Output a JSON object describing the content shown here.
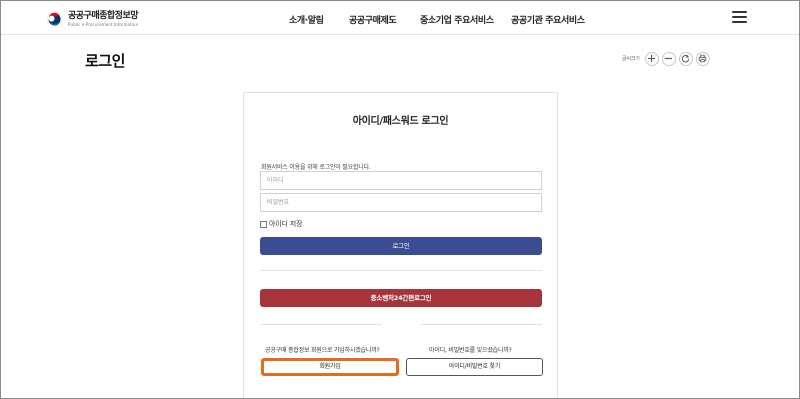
{
  "header": {
    "logo_text": "공공구매종합정보망",
    "logo_subtext": "Public e-Procurement Information",
    "nav": [
      {
        "label": "소개·알림"
      },
      {
        "label": "공공구매제도"
      },
      {
        "label": "중소기업 주요서비스"
      },
      {
        "label": "공공기관 주요서비스"
      }
    ],
    "menu_icon": "hamburger-menu-icon"
  },
  "page": {
    "title": "로그인",
    "zoom_label": "글씨크기",
    "tools": [
      "zoom-in-icon",
      "zoom-out-icon",
      "reset-icon",
      "print-icon"
    ]
  },
  "login": {
    "title": "아이디/패스워드 로그인",
    "notice": "회원서비스 이용을 위해 로그인이 필요합니다.",
    "id_placeholder": "아이디",
    "pw_placeholder": "비밀번호",
    "save_id_label": "아이디 저장",
    "login_button": "로그인",
    "venture_login_button": "중소벤처24간편로그인",
    "join_question": "공공구매 종합정보 회원으로 가입하시겠습니까?",
    "find_question": "아이디, 비밀번호를 잊으셨습니까?",
    "join_button": "회원가입",
    "find_button": "아이디/비밀번호 찾기"
  },
  "colors": {
    "login_button": "#3b4d92",
    "venture_button": "#a6343a",
    "join_highlight": "#e86a1e"
  }
}
